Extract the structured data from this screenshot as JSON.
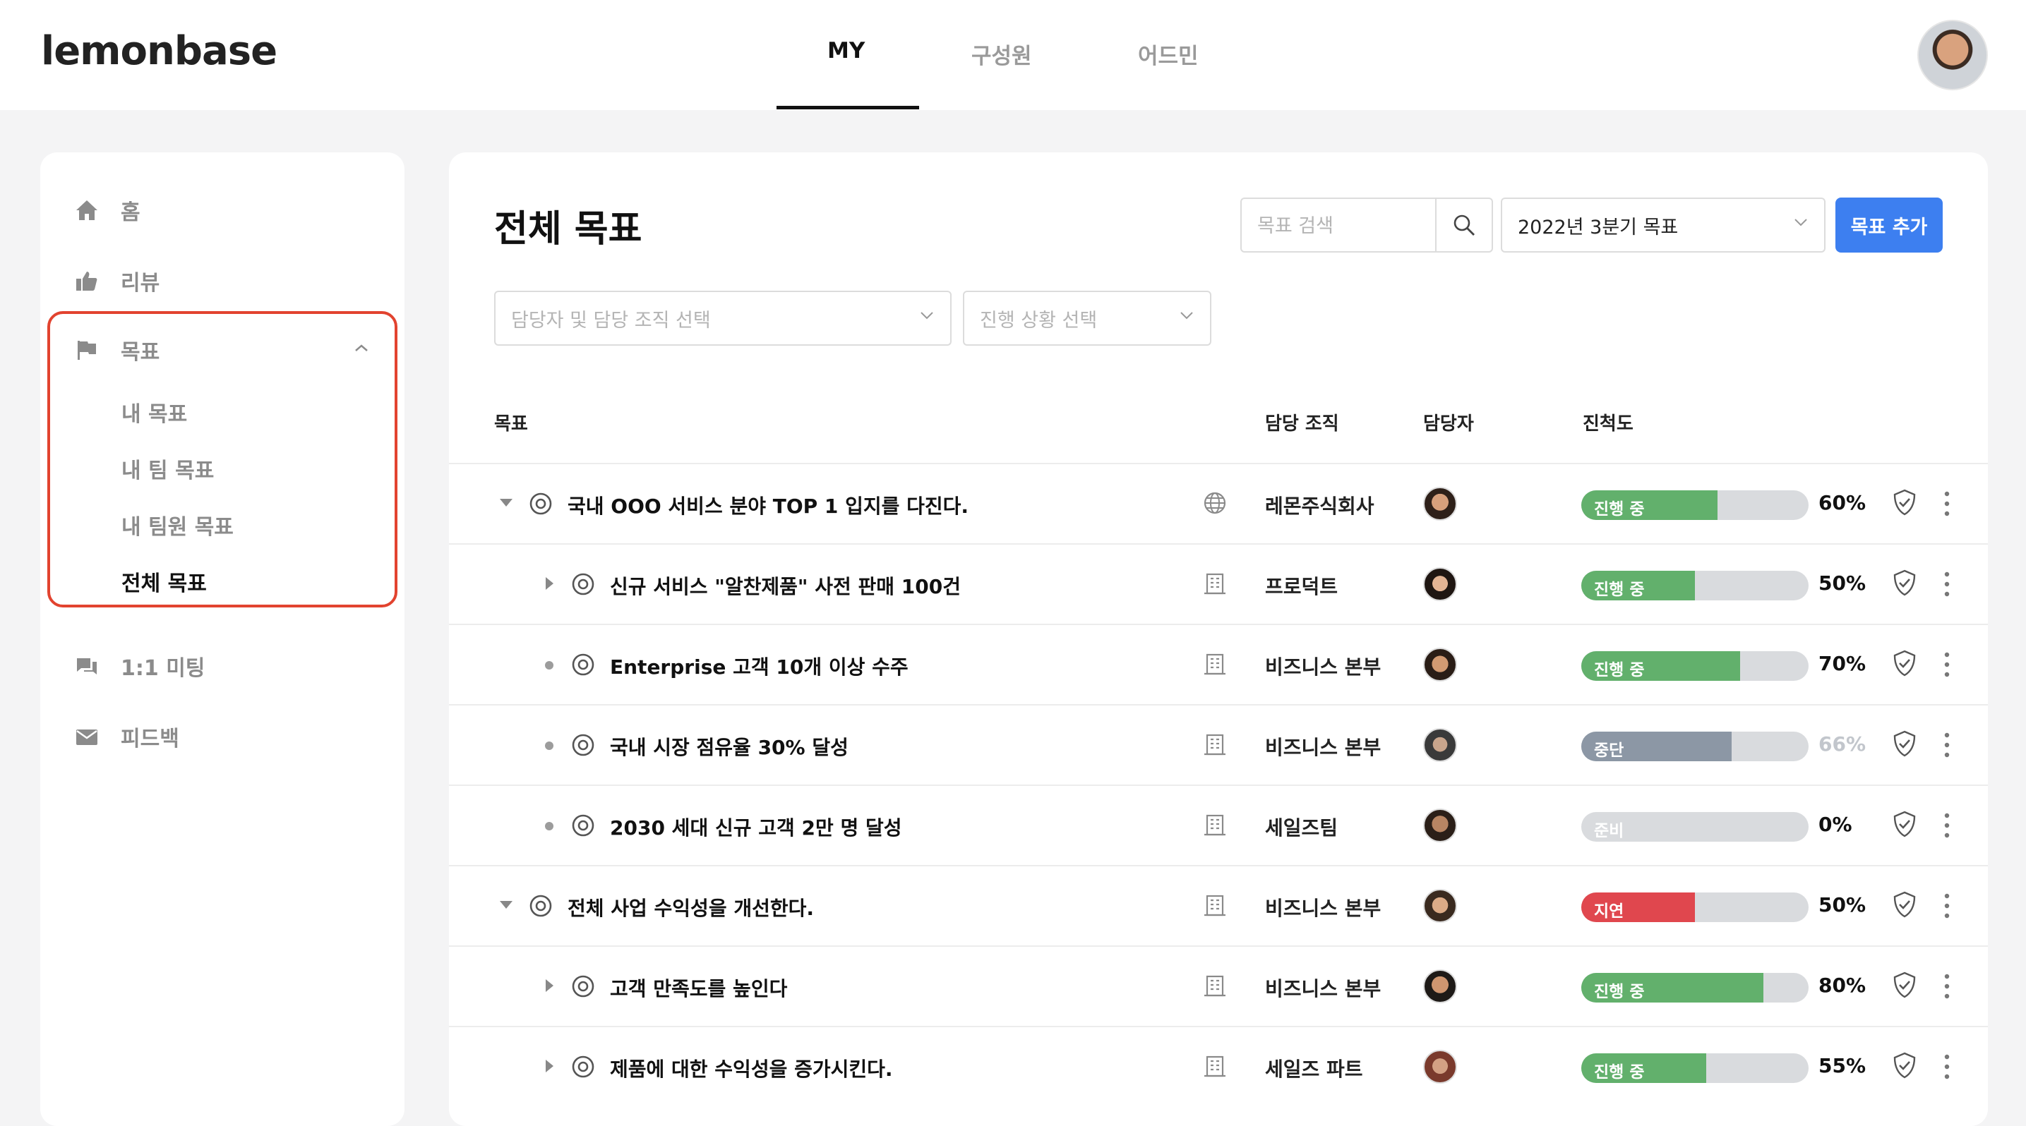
{
  "header": {
    "logo": "lemonbase",
    "tabs": [
      {
        "label": "MY",
        "active": true
      },
      {
        "label": "구성원",
        "active": false
      },
      {
        "label": "어드민",
        "active": false
      }
    ]
  },
  "sidebar": {
    "items": [
      {
        "label": "홈",
        "icon": "home-icon"
      },
      {
        "label": "리뷰",
        "icon": "thumbs-up-icon"
      },
      {
        "label": "목표",
        "icon": "flag-icon",
        "expanded": true
      },
      {
        "label": "1:1 미팅",
        "icon": "chat-icon"
      },
      {
        "label": "피드백",
        "icon": "mail-icon"
      }
    ],
    "goal_subitems": [
      {
        "label": "내 목표",
        "active": false
      },
      {
        "label": "내 팀 목표",
        "active": false
      },
      {
        "label": "내 팀원 목표",
        "active": false
      },
      {
        "label": "전체 목표",
        "active": true
      }
    ]
  },
  "main": {
    "title": "전체 목표",
    "search_placeholder": "목표 검색",
    "period_select": "2022년 3분기 목표",
    "add_button": "목표 추가",
    "filter_owner_placeholder": "담당자 및 담당 조직 선택",
    "filter_status_placeholder": "진행 상황 선택",
    "columns": {
      "goal": "목표",
      "org": "담당 조직",
      "owner": "담당자",
      "progress": "진척도"
    },
    "rows": [
      {
        "level": 0,
        "expander": "expanded",
        "goal": "국내 OOO 서비스 분야 TOP 1 입지를 다진다.",
        "org_icon": "globe-icon",
        "org": "레몬주식회사",
        "status": "진행 중",
        "progress": 0.6,
        "percent": "60%",
        "state": "progress"
      },
      {
        "level": 1,
        "expander": "collapsed",
        "goal": "신규 서비스 \"알찬제품\" 사전 판매 100건",
        "org_icon": "building-icon",
        "org": "프로덕트",
        "status": "진행 중",
        "progress": 0.5,
        "percent": "50%",
        "state": "progress"
      },
      {
        "level": 1,
        "expander": "leaf",
        "goal": "Enterprise 고객 10개 이상 수주",
        "org_icon": "building-icon",
        "org": "비즈니스 본부",
        "status": "진행 중",
        "progress": 0.7,
        "percent": "70%",
        "state": "progress"
      },
      {
        "level": 1,
        "expander": "leaf",
        "goal": "국내 시장 점유율 30% 달성",
        "org_icon": "building-icon",
        "org": "비즈니스 본부",
        "status": "중단",
        "progress": 0.66,
        "percent": "66%",
        "state": "stopped"
      },
      {
        "level": 1,
        "expander": "leaf",
        "goal": "2030 세대 신규 고객 2만 명 달성",
        "org_icon": "building-icon",
        "org": "세일즈팀",
        "status": "준비",
        "progress": 0.0,
        "percent": "0%",
        "state": "ready"
      },
      {
        "level": 0,
        "expander": "expanded",
        "goal": "전체 사업 수익성을 개선한다.",
        "org_icon": "building-icon",
        "org": "비즈니스 본부",
        "status": "지연",
        "progress": 0.5,
        "percent": "50%",
        "state": "delayed"
      },
      {
        "level": 1,
        "expander": "collapsed",
        "goal": "고객 만족도를 높인다",
        "org_icon": "building-icon",
        "org": "비즈니스 본부",
        "status": "진행 중",
        "progress": 0.8,
        "percent": "80%",
        "state": "progress"
      },
      {
        "level": 1,
        "expander": "collapsed",
        "goal": "제품에 대한 수익성을 증가시킨다.",
        "org_icon": "building-icon",
        "org": "세일즈 파트",
        "status": "진행 중",
        "progress": 0.55,
        "percent": "55%",
        "state": "progress"
      }
    ]
  },
  "colors": {
    "accent": "#3d7ff0",
    "progress": "#62b06c",
    "stopped": "#8c97a5",
    "delayed": "#e0474e",
    "ready": "#d9dbde",
    "highlight": "#e2432f"
  }
}
